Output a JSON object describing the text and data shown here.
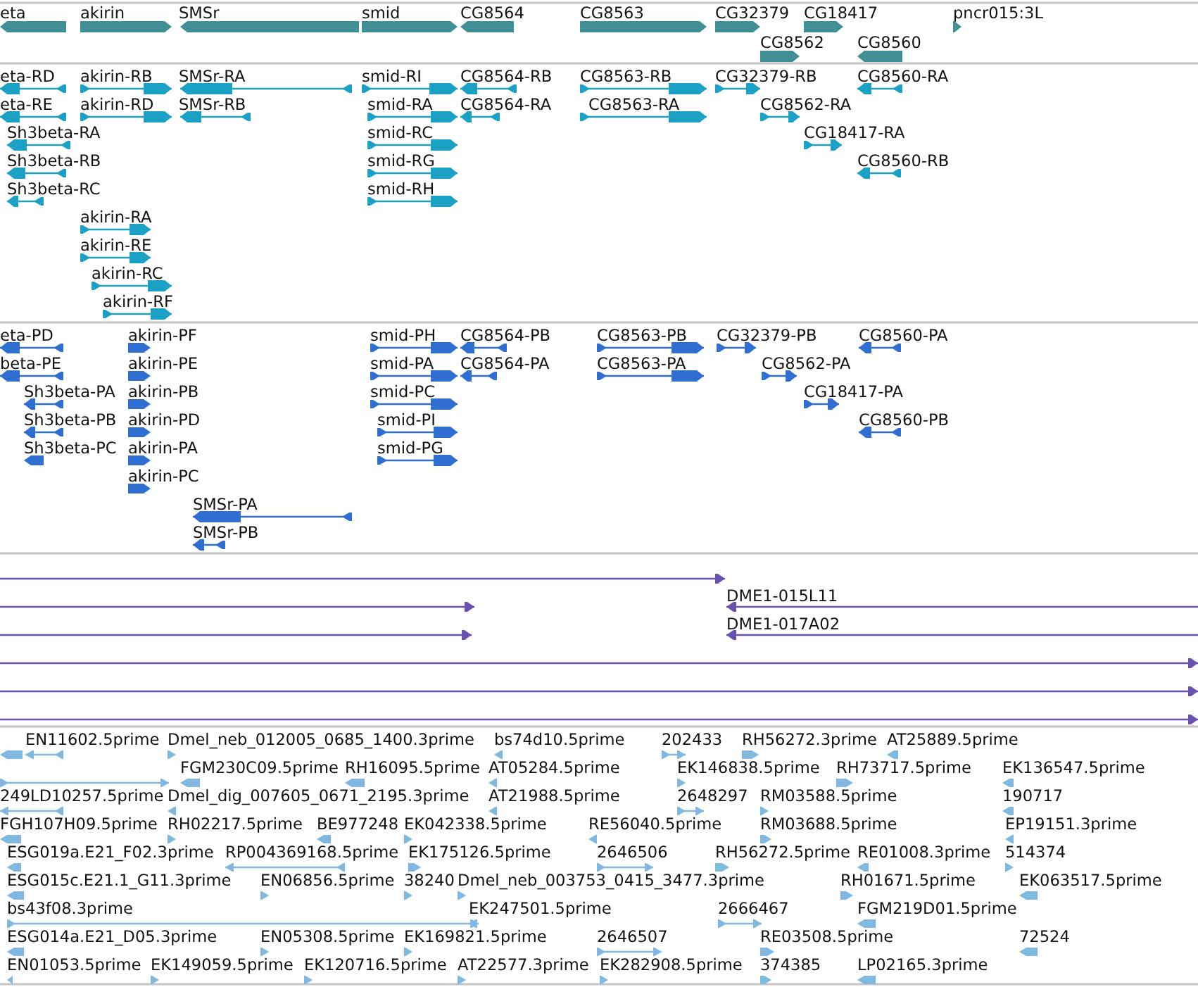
{
  "tracks": [
    {
      "kind": "gene",
      "features": [
        {
          "label": "eta",
          "reverse": true
        },
        {
          "label": "akirin",
          "reverse": false
        },
        {
          "label": "SMSr",
          "reverse": true
        },
        {
          "label": "smid",
          "reverse": false
        },
        {
          "label": "CG8564",
          "reverse": true
        },
        {
          "label": "CG8563",
          "reverse": false
        },
        {
          "label": "CG32379",
          "reverse": false
        },
        {
          "label": "CG18417",
          "reverse": false
        },
        {
          "label": "pncr015:3L",
          "reverse": false
        },
        {
          "label": "CG8562",
          "reverse": false
        },
        {
          "label": "CG8560",
          "reverse": true
        }
      ]
    },
    {
      "kind": "transcript",
      "features": [
        {
          "label": "eta-RD",
          "reverse": true
        },
        {
          "label": "akirin-RB",
          "reverse": false
        },
        {
          "label": "SMSr-RA",
          "reverse": true
        },
        {
          "label": "smid-RI",
          "reverse": false
        },
        {
          "label": "CG8564-RB",
          "reverse": true
        },
        {
          "label": "CG8563-RB",
          "reverse": false
        },
        {
          "label": "CG32379-RB",
          "reverse": false
        },
        {
          "label": "CG8560-RA",
          "reverse": true
        },
        {
          "label": "eta-RE",
          "reverse": true
        },
        {
          "label": "akirin-RD",
          "reverse": false
        },
        {
          "label": "SMSr-RB",
          "reverse": true
        },
        {
          "label": "smid-RA",
          "reverse": false
        },
        {
          "label": "CG8564-RA",
          "reverse": true
        },
        {
          "label": "CG8563-RA",
          "reverse": false
        },
        {
          "label": "CG8562-RA",
          "reverse": false
        },
        {
          "label": "Sh3beta-RA",
          "reverse": true
        },
        {
          "label": "smid-RC",
          "reverse": false
        },
        {
          "label": "CG18417-RA",
          "reverse": false
        },
        {
          "label": "Sh3beta-RB",
          "reverse": true
        },
        {
          "label": "smid-RG",
          "reverse": false
        },
        {
          "label": "CG8560-RB",
          "reverse": true
        },
        {
          "label": "Sh3beta-RC",
          "reverse": true
        },
        {
          "label": "smid-RH",
          "reverse": false
        },
        {
          "label": "akirin-RA",
          "reverse": false
        },
        {
          "label": "akirin-RE",
          "reverse": false
        },
        {
          "label": "akirin-RC",
          "reverse": false
        },
        {
          "label": "akirin-RF",
          "reverse": false
        }
      ]
    },
    {
      "kind": "protein",
      "features": [
        {
          "label": "eta-PD",
          "reverse": true
        },
        {
          "label": "akirin-PF",
          "reverse": false
        },
        {
          "label": "smid-PH",
          "reverse": false
        },
        {
          "label": "CG8564-PB",
          "reverse": true
        },
        {
          "label": "CG8563-PB",
          "reverse": false
        },
        {
          "label": "CG32379-PB",
          "reverse": false
        },
        {
          "label": "CG8560-PA",
          "reverse": true
        },
        {
          "label": "beta-PE",
          "reverse": true
        },
        {
          "label": "akirin-PE",
          "reverse": false
        },
        {
          "label": "smid-PA",
          "reverse": false
        },
        {
          "label": "CG8564-PA",
          "reverse": true
        },
        {
          "label": "CG8563-PA",
          "reverse": false
        },
        {
          "label": "CG8562-PA",
          "reverse": false
        },
        {
          "label": "Sh3beta-PA",
          "reverse": true
        },
        {
          "label": "akirin-PB",
          "reverse": false
        },
        {
          "label": "smid-PC",
          "reverse": false
        },
        {
          "label": "CG18417-PA",
          "reverse": false
        },
        {
          "label": "Sh3beta-PB",
          "reverse": true
        },
        {
          "label": "akirin-PD",
          "reverse": false
        },
        {
          "label": "smid-PI",
          "reverse": false
        },
        {
          "label": "CG8560-PB",
          "reverse": true
        },
        {
          "label": "Sh3beta-PC",
          "reverse": true
        },
        {
          "label": "akirin-PA",
          "reverse": false
        },
        {
          "label": "smid-PG",
          "reverse": false
        },
        {
          "label": "akirin-PC",
          "reverse": false
        },
        {
          "label": "SMSr-PA",
          "reverse": true
        },
        {
          "label": "SMSr-PB",
          "reverse": true
        }
      ]
    },
    {
      "kind": "clone",
      "features": [
        {
          "reverse": false
        },
        {
          "reverse": false
        },
        {
          "label": "DME1-015L11",
          "reverse": true
        },
        {
          "reverse": false
        },
        {
          "label": "DME1-017A02",
          "reverse": true
        },
        {
          "reverse": false
        },
        {
          "reverse": false
        },
        {
          "reverse": false
        }
      ]
    },
    {
      "kind": "est",
      "features": [
        {
          "reverse": true
        },
        {
          "label": "EN11602.5prime",
          "reverse": true
        },
        {
          "label": "Dmel_neb_012005_0685_1400.3prime",
          "reverse": false
        },
        {
          "label": "bs74d10.5prime",
          "reverse": true
        },
        {
          "label": "202433",
          "reverse": false
        },
        {
          "label": "RH56272.3prime",
          "reverse": false
        },
        {
          "label": "AT25889.5prime",
          "reverse": true
        },
        {
          "reverse": false
        },
        {
          "label": "FGM230C09.5prime",
          "reverse": true
        },
        {
          "label": "RH16095.5prime",
          "reverse": true
        },
        {
          "label": "AT05284.5prime",
          "reverse": true
        },
        {
          "label": "EK146838.5prime",
          "reverse": false
        },
        {
          "label": "RH73717.5prime",
          "reverse": false
        },
        {
          "label": "EK136547.5prime",
          "reverse": true
        },
        {
          "label": "249LD10257.5prime",
          "reverse": true
        },
        {
          "label": "Dmel_dig_007605_0671_2195.3prime",
          "reverse": true
        },
        {
          "label": "AT21988.5prime",
          "reverse": true
        },
        {
          "label": "2648297",
          "reverse": false
        },
        {
          "label": "RM03588.5prime",
          "reverse": false
        },
        {
          "label": "190717",
          "reverse": true
        },
        {
          "label": "FGH107H09.5prime",
          "reverse": true
        },
        {
          "label": "RH02217.5prime",
          "reverse": false
        },
        {
          "label": "BE977248",
          "reverse": true
        },
        {
          "label": "EK042338.5prime",
          "reverse": false
        },
        {
          "label": "RE56040.5prime",
          "reverse": true
        },
        {
          "label": "RM03688.5prime",
          "reverse": false
        },
        {
          "label": "EP19151.3prime",
          "reverse": true
        },
        {
          "label": "ESG019a.E21_F02.3prime",
          "reverse": true
        },
        {
          "label": "RP004369168.5prime",
          "reverse": true
        },
        {
          "label": "EK175126.5prime",
          "reverse": false
        },
        {
          "label": "2646506",
          "reverse": false
        },
        {
          "label": "RH56272.5prime",
          "reverse": false
        },
        {
          "label": "RE01008.3prime",
          "reverse": true
        },
        {
          "label": "514374",
          "reverse": false
        },
        {
          "label": "ESG015c.E21.1_G11.3prime",
          "reverse": true
        },
        {
          "label": "EN06856.5prime",
          "reverse": false
        },
        {
          "label": "38240",
          "reverse": false
        },
        {
          "label": "Dmel_neb_003753_0415_3477.3prime",
          "reverse": false
        },
        {
          "label": "RH01671.5prime",
          "reverse": false
        },
        {
          "label": "EK063517.5prime",
          "reverse": true
        },
        {
          "label": "bs43f08.3prime",
          "reverse": false
        },
        {
          "label": "EK247501.5prime",
          "reverse": true
        },
        {
          "label": "2666467",
          "reverse": false
        },
        {
          "label": "FGM219D01.5prime",
          "reverse": true
        },
        {
          "label": "ESG014a.E21_D05.3prime",
          "reverse": true
        },
        {
          "label": "EN05308.5prime",
          "reverse": false
        },
        {
          "label": "EK169821.5prime",
          "reverse": false
        },
        {
          "label": "2646507",
          "reverse": false
        },
        {
          "label": "RE03508.5prime",
          "reverse": false
        },
        {
          "label": "72524",
          "reverse": true
        },
        {
          "label": "EN01053.5prime",
          "reverse": true
        },
        {
          "label": "EK149059.5prime",
          "reverse": false
        },
        {
          "label": "EK120716.5prime",
          "reverse": false
        },
        {
          "label": "AT22577.3prime",
          "reverse": false
        },
        {
          "label": "EK282908.5prime",
          "reverse": false
        },
        {
          "label": "374385",
          "reverse": false
        },
        {
          "label": "LP02165.3prime",
          "reverse": true
        }
      ]
    }
  ]
}
